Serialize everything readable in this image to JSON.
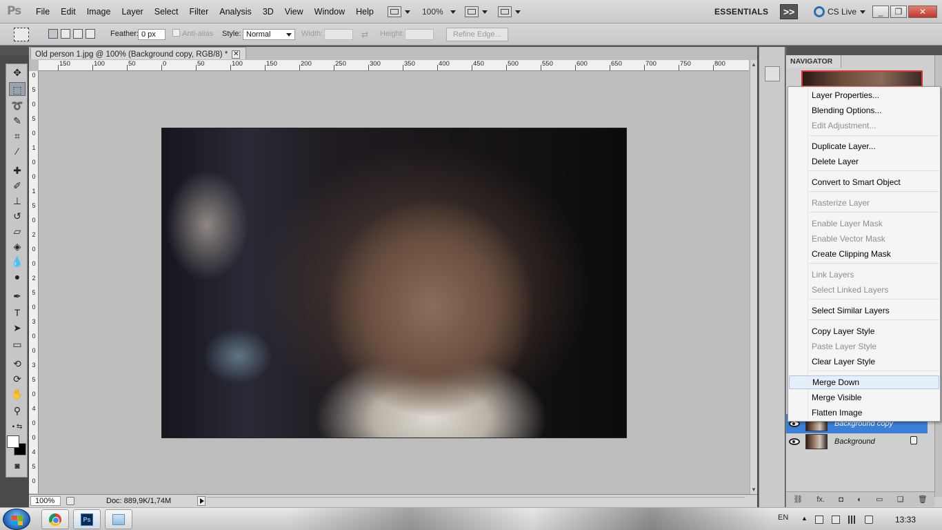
{
  "app": {
    "logo": "Ps",
    "menus": [
      "File",
      "Edit",
      "Image",
      "Layer",
      "Select",
      "Filter",
      "Analysis",
      "3D",
      "View",
      "Window",
      "Help"
    ],
    "zoom_menu": "100%",
    "workspace": "ESSENTIALS",
    "workspace_more": ">>",
    "cs_live": "CS Live",
    "window_buttons": {
      "minimize": "_",
      "restore": "❐",
      "close": "✕"
    }
  },
  "options": {
    "feather_label": "Feather:",
    "feather_value": "0 px",
    "anti_alias_label": "Anti-alias",
    "style_label": "Style:",
    "style_value": "Normal",
    "width_label": "Width:",
    "height_label": "Height:",
    "refine_edge": "Refine Edge..."
  },
  "document": {
    "tab_title": "Old person 1.jpg @ 100% (Background copy, RGB/8) *",
    "tab_close": "✕",
    "ruler_h": [
      "150",
      "100",
      "50",
      "0",
      "50",
      "100",
      "150",
      "200",
      "250",
      "300",
      "350",
      "400",
      "450",
      "500",
      "550",
      "600",
      "650",
      "700",
      "750",
      "800"
    ],
    "ruler_v": [
      "0",
      "5",
      "0",
      "5",
      "0",
      "1",
      "0",
      "0",
      "1",
      "5",
      "0",
      "2",
      "0",
      "0",
      "2",
      "5",
      "0",
      "3",
      "0",
      "0",
      "3",
      "5",
      "0",
      "4",
      "0",
      "0",
      "4",
      "5",
      "0"
    ],
    "zoom": "100%",
    "doc_size": "Doc: 889,9K/1,74M"
  },
  "panels": {
    "navigator_title": "NAVIGATOR",
    "layers": [
      {
        "name": "Background copy",
        "selected": true,
        "locked": false
      },
      {
        "name": "Background",
        "selected": false,
        "locked": true
      }
    ],
    "footer_icons": [
      "link-icon",
      "fx-icon",
      "mask-icon",
      "adjustment-icon",
      "folder-icon",
      "new-layer-icon",
      "trash-icon"
    ],
    "footer_fx": "fx."
  },
  "context_menu": {
    "items": [
      {
        "label": "Layer Properties...",
        "enabled": true
      },
      {
        "label": "Blending Options...",
        "enabled": true
      },
      {
        "label": "Edit Adjustment...",
        "enabled": false
      },
      {
        "label": "Duplicate Layer...",
        "enabled": true
      },
      {
        "label": "Delete Layer",
        "enabled": true
      },
      {
        "label": "Convert to Smart Object",
        "enabled": true
      },
      {
        "label": "Rasterize Layer",
        "enabled": false
      },
      {
        "label": "Enable Layer Mask",
        "enabled": false
      },
      {
        "label": "Enable Vector Mask",
        "enabled": false
      },
      {
        "label": "Create Clipping Mask",
        "enabled": true
      },
      {
        "label": "Link Layers",
        "enabled": false
      },
      {
        "label": "Select Linked Layers",
        "enabled": false
      },
      {
        "label": "Select Similar Layers",
        "enabled": true
      },
      {
        "label": "Copy Layer Style",
        "enabled": true
      },
      {
        "label": "Paste Layer Style",
        "enabled": false
      },
      {
        "label": "Clear Layer Style",
        "enabled": true
      },
      {
        "label": "Merge Down",
        "enabled": true,
        "hover": true
      },
      {
        "label": "Merge Visible",
        "enabled": true
      },
      {
        "label": "Flatten Image",
        "enabled": true
      }
    ]
  },
  "taskbar": {
    "ps_label": "Ps",
    "language": "EN",
    "clock": "13:33"
  },
  "colors": {
    "selection_blue": "#3b7fd6",
    "menu_hover": "#e6eff9",
    "ui_gray": "#c9c9c9"
  }
}
